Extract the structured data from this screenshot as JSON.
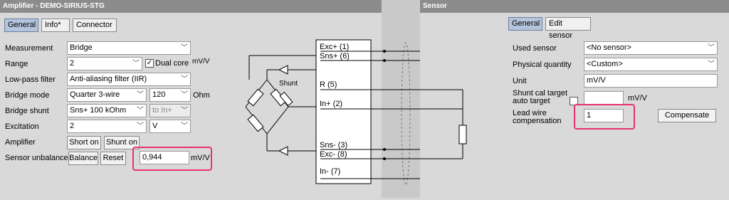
{
  "left": {
    "title": "Amplifier - DEMO-SIRIUS-STG",
    "tabs": [
      "General",
      "Info*",
      "Connector"
    ],
    "rows": {
      "measurement": {
        "label": "Measurement",
        "value": "Bridge"
      },
      "range": {
        "label": "Range",
        "value": "2",
        "dual_core": "Dual core",
        "unit": "mV/V"
      },
      "lowpass": {
        "label": "Low-pass filter",
        "value": "Anti-aliasing filter (IIR)"
      },
      "bridge_mode": {
        "label": "Bridge mode",
        "value": "Quarter 3-wire",
        "ohm_value": "120",
        "ohm_unit": "Ohm"
      },
      "bridge_shunt": {
        "label": "Bridge shunt",
        "value": "Sns+ 100 kOhm",
        "target": "to In+"
      },
      "excitation": {
        "label": "Excitation",
        "value": "2",
        "unit": "V"
      },
      "amplifier": {
        "label": "Amplifier",
        "short_on": "Short on",
        "shunt_on": "Shunt on"
      },
      "sensor_unbalance": {
        "label": "Sensor unbalance",
        "balance": "Balance",
        "reset": "Reset",
        "value": "0,944",
        "unit": "mV/V"
      }
    }
  },
  "schematic": {
    "exc_plus": "Exc+ (1)",
    "sns_plus": "Sns+ (6)",
    "r": "R (5)",
    "in_plus": "In+ (2)",
    "sns_minus": "Sns- (3)",
    "exc_minus": "Exc- (8)",
    "in_minus": "In- (7)",
    "shunt": "Shunt"
  },
  "right": {
    "title": "Sensor",
    "tabs": [
      "General",
      "Edit sensor"
    ],
    "used_sensor": {
      "label": "Used sensor",
      "value": "<No sensor>"
    },
    "physical_quantity": {
      "label": "Physical quantity",
      "value": "<Custom>"
    },
    "unit": {
      "label": "Unit",
      "value": "mV/V"
    },
    "shunt_cal": {
      "label_line1": "Shunt cal target",
      "label_line2": "auto target",
      "value": "",
      "unit": "mV/V"
    },
    "lead_wire": {
      "label_line1": "Lead wire",
      "label_line2": "compensation",
      "value": "1",
      "button": "Compensate"
    }
  },
  "colors": {
    "highlight": "#e8346a",
    "active_tab": "#b4c4dc",
    "title_bar": "#8c8c8c"
  }
}
